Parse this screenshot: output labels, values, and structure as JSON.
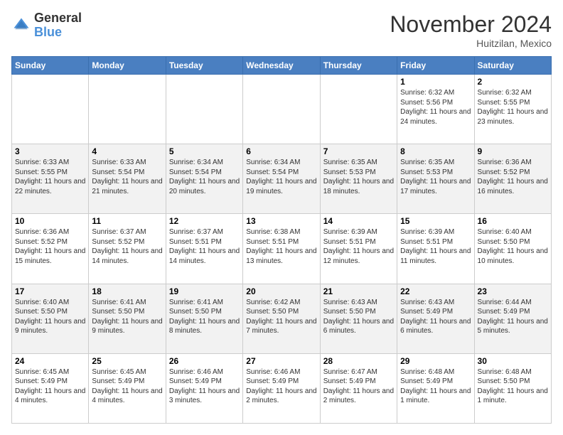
{
  "header": {
    "logo_general": "General",
    "logo_blue": "Blue",
    "month_title": "November 2024",
    "location": "Huitzilan, Mexico"
  },
  "days_of_week": [
    "Sunday",
    "Monday",
    "Tuesday",
    "Wednesday",
    "Thursday",
    "Friday",
    "Saturday"
  ],
  "weeks": [
    [
      {
        "day": "",
        "info": ""
      },
      {
        "day": "",
        "info": ""
      },
      {
        "day": "",
        "info": ""
      },
      {
        "day": "",
        "info": ""
      },
      {
        "day": "",
        "info": ""
      },
      {
        "day": "1",
        "info": "Sunrise: 6:32 AM\nSunset: 5:56 PM\nDaylight: 11 hours and 24 minutes."
      },
      {
        "day": "2",
        "info": "Sunrise: 6:32 AM\nSunset: 5:55 PM\nDaylight: 11 hours and 23 minutes."
      }
    ],
    [
      {
        "day": "3",
        "info": "Sunrise: 6:33 AM\nSunset: 5:55 PM\nDaylight: 11 hours and 22 minutes."
      },
      {
        "day": "4",
        "info": "Sunrise: 6:33 AM\nSunset: 5:54 PM\nDaylight: 11 hours and 21 minutes."
      },
      {
        "day": "5",
        "info": "Sunrise: 6:34 AM\nSunset: 5:54 PM\nDaylight: 11 hours and 20 minutes."
      },
      {
        "day": "6",
        "info": "Sunrise: 6:34 AM\nSunset: 5:54 PM\nDaylight: 11 hours and 19 minutes."
      },
      {
        "day": "7",
        "info": "Sunrise: 6:35 AM\nSunset: 5:53 PM\nDaylight: 11 hours and 18 minutes."
      },
      {
        "day": "8",
        "info": "Sunrise: 6:35 AM\nSunset: 5:53 PM\nDaylight: 11 hours and 17 minutes."
      },
      {
        "day": "9",
        "info": "Sunrise: 6:36 AM\nSunset: 5:52 PM\nDaylight: 11 hours and 16 minutes."
      }
    ],
    [
      {
        "day": "10",
        "info": "Sunrise: 6:36 AM\nSunset: 5:52 PM\nDaylight: 11 hours and 15 minutes."
      },
      {
        "day": "11",
        "info": "Sunrise: 6:37 AM\nSunset: 5:52 PM\nDaylight: 11 hours and 14 minutes."
      },
      {
        "day": "12",
        "info": "Sunrise: 6:37 AM\nSunset: 5:51 PM\nDaylight: 11 hours and 14 minutes."
      },
      {
        "day": "13",
        "info": "Sunrise: 6:38 AM\nSunset: 5:51 PM\nDaylight: 11 hours and 13 minutes."
      },
      {
        "day": "14",
        "info": "Sunrise: 6:39 AM\nSunset: 5:51 PM\nDaylight: 11 hours and 12 minutes."
      },
      {
        "day": "15",
        "info": "Sunrise: 6:39 AM\nSunset: 5:51 PM\nDaylight: 11 hours and 11 minutes."
      },
      {
        "day": "16",
        "info": "Sunrise: 6:40 AM\nSunset: 5:50 PM\nDaylight: 11 hours and 10 minutes."
      }
    ],
    [
      {
        "day": "17",
        "info": "Sunrise: 6:40 AM\nSunset: 5:50 PM\nDaylight: 11 hours and 9 minutes."
      },
      {
        "day": "18",
        "info": "Sunrise: 6:41 AM\nSunset: 5:50 PM\nDaylight: 11 hours and 9 minutes."
      },
      {
        "day": "19",
        "info": "Sunrise: 6:41 AM\nSunset: 5:50 PM\nDaylight: 11 hours and 8 minutes."
      },
      {
        "day": "20",
        "info": "Sunrise: 6:42 AM\nSunset: 5:50 PM\nDaylight: 11 hours and 7 minutes."
      },
      {
        "day": "21",
        "info": "Sunrise: 6:43 AM\nSunset: 5:50 PM\nDaylight: 11 hours and 6 minutes."
      },
      {
        "day": "22",
        "info": "Sunrise: 6:43 AM\nSunset: 5:49 PM\nDaylight: 11 hours and 6 minutes."
      },
      {
        "day": "23",
        "info": "Sunrise: 6:44 AM\nSunset: 5:49 PM\nDaylight: 11 hours and 5 minutes."
      }
    ],
    [
      {
        "day": "24",
        "info": "Sunrise: 6:45 AM\nSunset: 5:49 PM\nDaylight: 11 hours and 4 minutes."
      },
      {
        "day": "25",
        "info": "Sunrise: 6:45 AM\nSunset: 5:49 PM\nDaylight: 11 hours and 4 minutes."
      },
      {
        "day": "26",
        "info": "Sunrise: 6:46 AM\nSunset: 5:49 PM\nDaylight: 11 hours and 3 minutes."
      },
      {
        "day": "27",
        "info": "Sunrise: 6:46 AM\nSunset: 5:49 PM\nDaylight: 11 hours and 2 minutes."
      },
      {
        "day": "28",
        "info": "Sunrise: 6:47 AM\nSunset: 5:49 PM\nDaylight: 11 hours and 2 minutes."
      },
      {
        "day": "29",
        "info": "Sunrise: 6:48 AM\nSunset: 5:49 PM\nDaylight: 11 hours and 1 minute."
      },
      {
        "day": "30",
        "info": "Sunrise: 6:48 AM\nSunset: 5:50 PM\nDaylight: 11 hours and 1 minute."
      }
    ]
  ]
}
